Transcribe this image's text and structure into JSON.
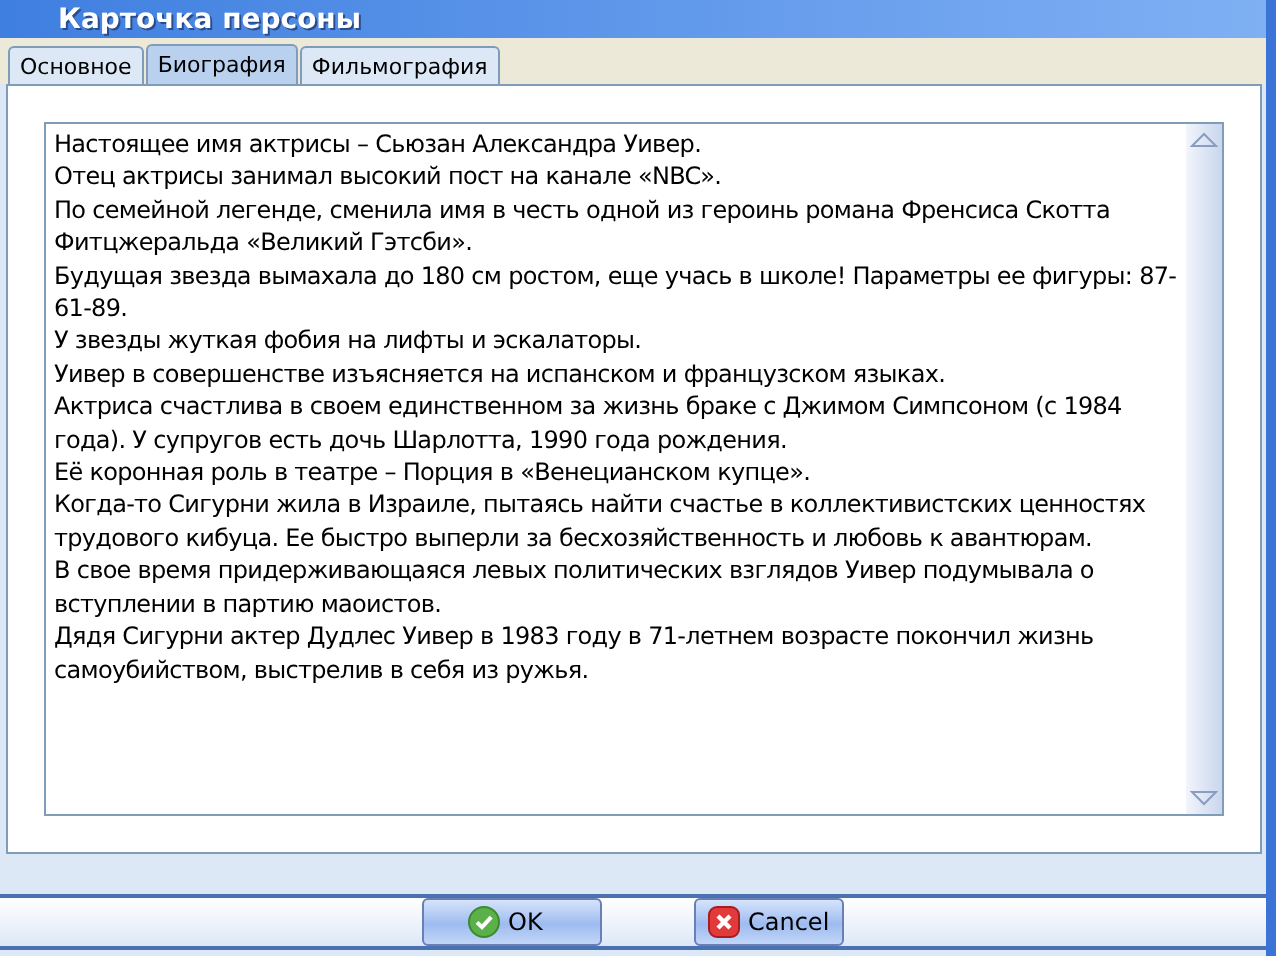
{
  "window": {
    "title": "Карточка персоны"
  },
  "tabs": [
    {
      "label": "Основное",
      "selected": false
    },
    {
      "label": "Биография",
      "selected": true
    },
    {
      "label": "Фильмография",
      "selected": false
    }
  ],
  "biography": [
    "Настоящее имя актрисы – Сьюзан Александра Уивер.",
    "Отец актрисы занимал высокий пост на канале «NBC».",
    "По семейной легенде, сменила имя в честь одной из героинь романа Френсиса Скотта Фитцжеральда «Великий Гэтсби».",
    "Будущая звезда вымахала до 180 см ростом, еще учась в школе! Параметры ее фигуры: 87-61-89.",
    "У звезды жуткая фобия на лифты и эскалаторы.",
    "Уивер в совершенстве изъясняется на испанском и французском языках.",
    "Актриса счастлива в своем единственном за жизнь браке с Джимом Симпсоном (с 1984 года). У супругов есть дочь Шарлотта, 1990 года рождения.",
    "Её коронная роль в театре – Порция в «Венецианском купце».",
    "Когда-то Сигурни жила в Израиле, пытаясь найти счастье в коллективистских ценностях трудового кибуца. Ее быстро выперли за бесхозяйственность и любовь к авантюрам.",
    "В свое время придерживающаяся левых политических взглядов Уивер подумывала о вступлении в партию маоистов.",
    "Дядя Сигурни актер Дудлес Уивер в 1983 году в 71-летнем возрасте покончил жизнь самоубийством, выстрелив в себя из ружья."
  ],
  "buttons": [
    {
      "kind": "ok",
      "label": "OK"
    },
    {
      "kind": "cancel",
      "label": "Cancel"
    }
  ]
}
